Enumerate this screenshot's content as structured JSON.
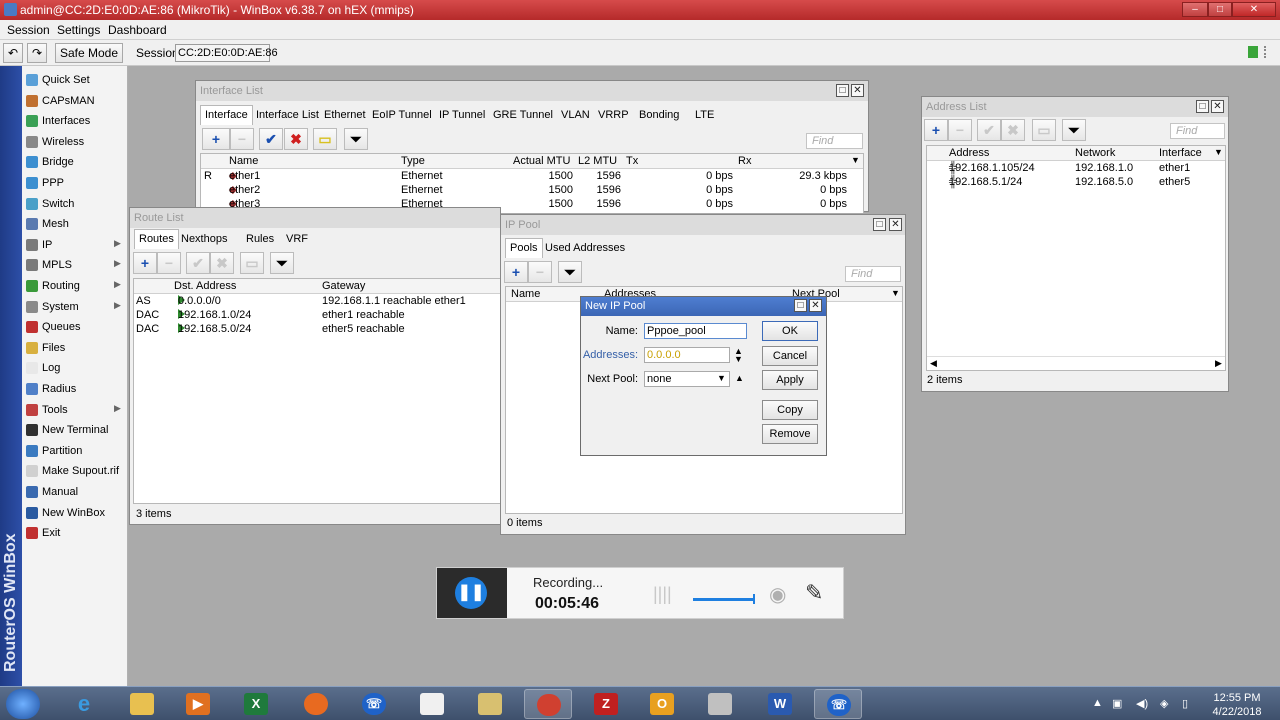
{
  "window": {
    "title": "admin@CC:2D:E0:0D:AE:86 (MikroTik) - WinBox v6.38.7 on hEX (mmips)"
  },
  "menu": [
    "Session",
    "Settings",
    "Dashboard"
  ],
  "toolbar": {
    "safe_mode": "Safe Mode",
    "session_label": "Session:",
    "session_value": "CC:2D:E0:0D:AE:86"
  },
  "brand_vertical": "RouterOS WinBox",
  "sidebar": [
    {
      "label": "Quick Set",
      "icon": "quick-set-icon",
      "color": "#5aa0d8",
      "sub": false
    },
    {
      "label": "CAPsMAN",
      "icon": "capsman-icon",
      "color": "#c07030",
      "sub": false
    },
    {
      "label": "Interfaces",
      "icon": "interfaces-icon",
      "color": "#3aa055",
      "sub": false
    },
    {
      "label": "Wireless",
      "icon": "wireless-icon",
      "color": "#888888",
      "sub": false
    },
    {
      "label": "Bridge",
      "icon": "bridge-icon",
      "color": "#3c8fd0",
      "sub": false
    },
    {
      "label": "PPP",
      "icon": "ppp-icon",
      "color": "#3c8fd0",
      "sub": false
    },
    {
      "label": "Switch",
      "icon": "switch-icon",
      "color": "#4aa0c8",
      "sub": false
    },
    {
      "label": "Mesh",
      "icon": "mesh-icon",
      "color": "#5a7ab0",
      "sub": false
    },
    {
      "label": "IP",
      "icon": "ip-icon",
      "color": "#7a7a7a",
      "sub": true
    },
    {
      "label": "MPLS",
      "icon": "mpls-icon",
      "color": "#7a7a7a",
      "sub": true
    },
    {
      "label": "Routing",
      "icon": "routing-icon",
      "color": "#3a9a3a",
      "sub": true
    },
    {
      "label": "System",
      "icon": "system-icon",
      "color": "#8a8a8a",
      "sub": true
    },
    {
      "label": "Queues",
      "icon": "queues-icon",
      "color": "#c03030",
      "sub": false
    },
    {
      "label": "Files",
      "icon": "files-icon",
      "color": "#d8b040",
      "sub": false
    },
    {
      "label": "Log",
      "icon": "log-icon",
      "color": "#e8e8e8",
      "sub": false
    },
    {
      "label": "Radius",
      "icon": "radius-icon",
      "color": "#5080c8",
      "sub": false
    },
    {
      "label": "Tools",
      "icon": "tools-icon",
      "color": "#c04040",
      "sub": true
    },
    {
      "label": "New Terminal",
      "icon": "terminal-icon",
      "color": "#303030",
      "sub": false
    },
    {
      "label": "Partition",
      "icon": "partition-icon",
      "color": "#3a7ac0",
      "sub": false
    },
    {
      "label": "Make Supout.rif",
      "icon": "supout-icon",
      "color": "#d0d0d0",
      "sub": false
    },
    {
      "label": "Manual",
      "icon": "manual-icon",
      "color": "#3a6ab0",
      "sub": false
    },
    {
      "label": "New WinBox",
      "icon": "winbox-icon",
      "color": "#2a5aa0",
      "sub": false
    },
    {
      "label": "Exit",
      "icon": "exit-icon",
      "color": "#c03030",
      "sub": false
    }
  ],
  "interface_list": {
    "title": "Interface List",
    "tabs": [
      "Interface",
      "Interface List",
      "Ethernet",
      "EoIP Tunnel",
      "IP Tunnel",
      "GRE Tunnel",
      "VLAN",
      "VRRP",
      "Bonding",
      "LTE"
    ],
    "find": "Find",
    "columns": [
      "Name",
      "Type",
      "Actual MTU",
      "L2 MTU",
      "Tx",
      "Rx"
    ],
    "rows": [
      {
        "flag": "R",
        "name": "ether1",
        "type": "Ethernet",
        "mtu": "1500",
        "l2mtu": "1596",
        "tx": "0 bps",
        "rx": "29.3 kbps"
      },
      {
        "flag": "",
        "name": "ether2",
        "type": "Ethernet",
        "mtu": "1500",
        "l2mtu": "1596",
        "tx": "0 bps",
        "rx": "0 bps"
      },
      {
        "flag": "",
        "name": "ether3",
        "type": "Ethernet",
        "mtu": "1500",
        "l2mtu": "1596",
        "tx": "0 bps",
        "rx": "0 bps"
      }
    ]
  },
  "route_list": {
    "title": "Route List",
    "tabs": [
      "Routes",
      "Nexthops",
      "Rules",
      "VRF"
    ],
    "columns": [
      "Dst. Address",
      "Gateway"
    ],
    "rows": [
      {
        "flag": "AS",
        "dst": "0.0.0.0/0",
        "gw": "192.168.1.1 reachable ether1"
      },
      {
        "flag": "DAC",
        "dst": "192.168.1.0/24",
        "gw": "ether1 reachable"
      },
      {
        "flag": "DAC",
        "dst": "192.168.5.0/24",
        "gw": "ether5 reachable"
      }
    ],
    "status": "3 items"
  },
  "ip_pool": {
    "title": "IP Pool",
    "tabs": [
      "Pools",
      "Used Addresses"
    ],
    "find": "Find",
    "columns": [
      "Name",
      "Addresses",
      "Next Pool"
    ],
    "status": "0 items"
  },
  "new_pool": {
    "title": "New IP Pool",
    "name_label": "Name:",
    "name_value": "Pppoe_pool",
    "addresses_label": "Addresses:",
    "addresses_value": "0.0.0.0",
    "next_pool_label": "Next Pool:",
    "next_pool_value": "none",
    "buttons": {
      "ok": "OK",
      "cancel": "Cancel",
      "apply": "Apply",
      "copy": "Copy",
      "remove": "Remove"
    }
  },
  "address_list": {
    "title": "Address List",
    "find": "Find",
    "columns": [
      "Address",
      "Network",
      "Interface"
    ],
    "rows": [
      {
        "address": "192.168.1.105/24",
        "network": "192.168.1.0",
        "iface": "ether1"
      },
      {
        "address": "192.168.5.1/24",
        "network": "192.168.5.0",
        "iface": "ether5"
      }
    ],
    "status": "2 items"
  },
  "recorder": {
    "title": "Recording...",
    "time": "00:05:46"
  },
  "clock": {
    "time": "12:55 PM",
    "date": "4/22/2018"
  },
  "colors": {
    "title_bar": "#c43a3a",
    "active_title": "#3c66b5",
    "sidebar_band": "#2d4fa8"
  }
}
